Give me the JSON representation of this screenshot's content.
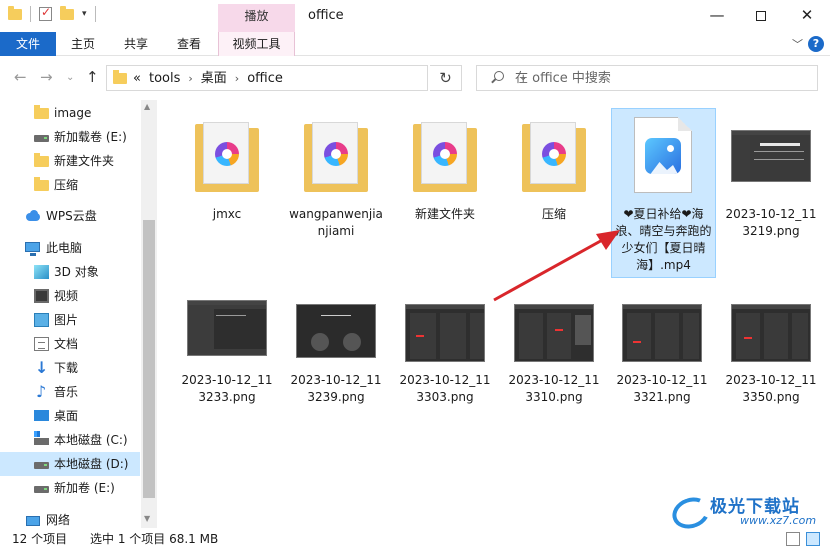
{
  "window": {
    "title": "office",
    "context_tab_header": "播放",
    "min_glyph": "—",
    "close_glyph": "✕"
  },
  "ribbon": {
    "tabs": [
      "文件",
      "主页",
      "共享",
      "查看",
      "视频工具"
    ],
    "caret": "﹀",
    "help": "?"
  },
  "address": {
    "prefix": "«",
    "crumbs": [
      "tools",
      "桌面",
      "office"
    ],
    "separator": "›",
    "dropdown": "⌄",
    "refresh": "↻"
  },
  "search": {
    "placeholder": "在 office 中搜索"
  },
  "nav": {
    "back": "←",
    "forward": "→",
    "recent": "⌄",
    "up": "↑"
  },
  "sidebar": {
    "items": [
      {
        "label": "image",
        "icon": "folder-icon"
      },
      {
        "label": "新加载卷 (E:)",
        "icon": "drive-icon"
      },
      {
        "label": "新建文件夹",
        "icon": "folder-icon"
      },
      {
        "label": "压缩",
        "icon": "folder-icon"
      },
      {
        "label": "WPS云盘",
        "icon": "cloud-icon"
      },
      {
        "label": "此电脑",
        "icon": "computer-icon"
      },
      {
        "label": "3D 对象",
        "icon": "cube-icon"
      },
      {
        "label": "视频",
        "icon": "video-icon"
      },
      {
        "label": "图片",
        "icon": "picture-icon"
      },
      {
        "label": "文档",
        "icon": "document-icon"
      },
      {
        "label": "下载",
        "icon": "download-icon"
      },
      {
        "label": "音乐",
        "icon": "music-icon"
      },
      {
        "label": "桌面",
        "icon": "desktop-icon"
      },
      {
        "label": "本地磁盘 (C:)",
        "icon": "os-drive-icon"
      },
      {
        "label": "本地磁盘 (D:)",
        "icon": "drive-icon"
      },
      {
        "label": "新加卷 (E:)",
        "icon": "drive-icon"
      },
      {
        "label": "网络",
        "icon": "network-icon"
      }
    ],
    "selected": "本地磁盘 (D:)"
  },
  "files": [
    {
      "name": "jmxc",
      "type": "folder"
    },
    {
      "name": "wangpanwenjianjiami",
      "type": "folder"
    },
    {
      "name": "新建文件夹",
      "type": "folder"
    },
    {
      "name": "压缩",
      "type": "folder"
    },
    {
      "name": "❤夏日补给❤海浪、晴空与奔跑的少女们【夏日晴海】.mp4",
      "type": "video",
      "selected": true
    },
    {
      "name": "2023-10-12_113219.png",
      "type": "image"
    },
    {
      "name": "2023-10-12_113233.png",
      "type": "image"
    },
    {
      "name": "2023-10-12_113239.png",
      "type": "image"
    },
    {
      "name": "2023-10-12_113303.png",
      "type": "image"
    },
    {
      "name": "2023-10-12_113310.png",
      "type": "image"
    },
    {
      "name": "2023-10-12_113321.png",
      "type": "image"
    },
    {
      "name": "2023-10-12_113350.png",
      "type": "image"
    }
  ],
  "status": {
    "count": "12 个项目",
    "selection": "选中 1 个项目  68.1 MB"
  },
  "watermark": {
    "title": "极光下载站",
    "url": "www.xz7.com"
  },
  "colors": {
    "accent": "#1b6ac9",
    "selection": "#cce8ff",
    "context_tab": "#f7d9ea",
    "arrow": "#d9262b",
    "folder": "#f6cd5c"
  }
}
